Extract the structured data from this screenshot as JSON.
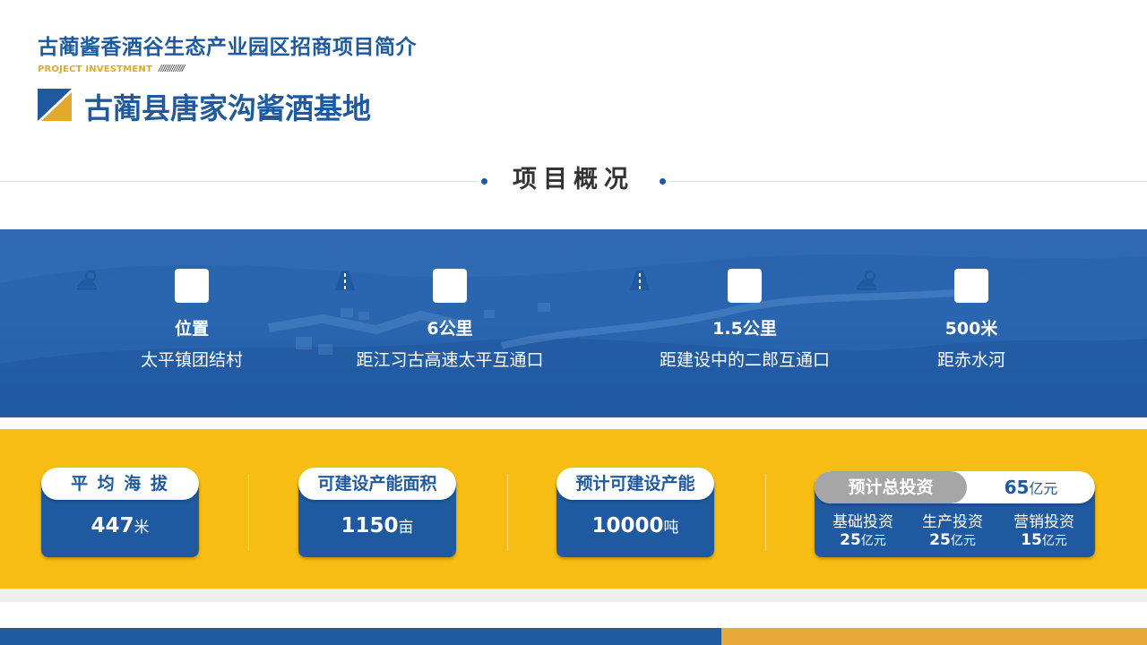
{
  "header": {
    "title": "古蔺酱香酒谷生态产业园区招商项目简介",
    "eng": "PROJECT INVESTMENT",
    "slashes": "////////////",
    "subtitle": "古蔺县唐家沟酱酒基地"
  },
  "section": {
    "title": "项目概况"
  },
  "features": [
    {
      "icon": "map-pin-icon",
      "value": "位置",
      "desc": "太平镇团结村"
    },
    {
      "icon": "road-icon",
      "value": "6公里",
      "desc": "距江习古高速太平互通口"
    },
    {
      "icon": "road-icon",
      "value": "1.5公里",
      "desc": "距建设中的二郎互通口"
    },
    {
      "icon": "map-pin-icon",
      "value": "500米",
      "desc": "距赤水河"
    }
  ],
  "stats": [
    {
      "label": "平 均 海 拔",
      "value": "447",
      "unit": "米"
    },
    {
      "label": "可建设产能面积",
      "value": "1150",
      "unit": "亩"
    },
    {
      "label": "预计可建设产能",
      "value": "10000",
      "unit": "吨"
    }
  ],
  "investment": {
    "label": "预计总投资",
    "total": "65",
    "total_unit": "亿元",
    "items": [
      {
        "label": "基础投资",
        "value": "25",
        "unit": "亿元"
      },
      {
        "label": "生产投资",
        "value": "25",
        "unit": "亿元"
      },
      {
        "label": "营销投资",
        "value": "15",
        "unit": "亿元"
      }
    ]
  },
  "colors": {
    "brand_blue": "#1f5aa0",
    "accent_yellow": "#f8bd12",
    "accent_orange": "#e3a72a"
  }
}
